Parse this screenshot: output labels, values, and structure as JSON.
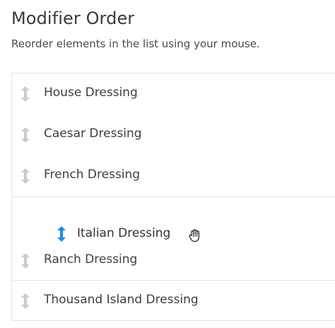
{
  "header": {
    "title": "Modifier Order",
    "subtitle": "Reorder elements in the list using your mouse."
  },
  "list": {
    "items": [
      {
        "label": "House Dressing",
        "icon": "drag-handle-icon"
      },
      {
        "label": "Caesar Dressing",
        "icon": "drag-handle-icon"
      },
      {
        "label": "French Dressing",
        "icon": "drag-handle-icon"
      },
      {
        "label": "Ranch Dressing",
        "icon": "drag-handle-icon"
      },
      {
        "label": "Thousand Island Dressing",
        "icon": "drag-handle-icon"
      }
    ],
    "dragging_item": {
      "label": "Italian Dressing",
      "icon": "drag-handle-icon"
    }
  },
  "colors": {
    "drag_handle_idle": "#c8cbce",
    "drag_handle_active": "#1e88e5",
    "divider": "#e2e4e6"
  },
  "cursor": {
    "icon": "grab-hand-cursor-icon"
  }
}
